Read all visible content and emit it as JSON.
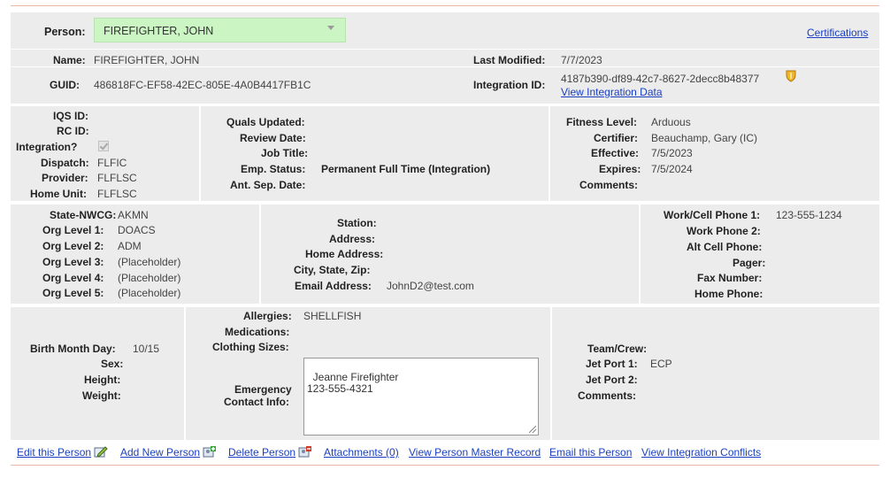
{
  "header": {
    "person_label": "Person:",
    "person_selected": "FIREFIGHTER, JOHN",
    "certifications_link": "Certifications"
  },
  "summary": {
    "name_label": "Name:",
    "name_value": "FIREFIGHTER, JOHN",
    "guid_label": "GUID:",
    "guid_value": "486818FC-EF58-42EC-805E-4A0B4417FB1C",
    "last_modified_label": "Last Modified:",
    "last_modified_value": "7/7/2023",
    "integration_id_label": "Integration ID:",
    "integration_id_value": "4187b390-df89-42c7-8627-2decc8b48377",
    "view_integration_data": "View Integration Data"
  },
  "ids": {
    "iqs_label": "IQS ID:",
    "rc_label": "RC ID:",
    "integration_label": "Integration?",
    "dispatch_label": "Dispatch:",
    "dispatch_value": "FLFIC",
    "provider_label": "Provider:",
    "provider_value": "FLFLSC",
    "home_unit_label": "Home Unit:",
    "home_unit_value": "FLFLSC"
  },
  "employment": {
    "quals_updated_label": "Quals Updated:",
    "review_date_label": "Review Date:",
    "job_title_label": "Job Title:",
    "emp_status_label": "Emp. Status:",
    "emp_status_value": "Permanent Full Time (Integration)",
    "ant_sep_label": "Ant. Sep. Date:"
  },
  "fitness": {
    "fitness_level_label": "Fitness Level:",
    "fitness_level_value": "Arduous",
    "certifier_label": "Certifier:",
    "certifier_value": "Beauchamp, Gary (IC)",
    "effective_label": "Effective:",
    "effective_value": "7/5/2023",
    "expires_label": "Expires:",
    "expires_value": "7/5/2024",
    "comments_label": "Comments:"
  },
  "org": {
    "state_label": "State-NWCG:",
    "state_value": "AKMN",
    "l1_label": "Org Level 1:",
    "l1_value": "DOACS",
    "l2_label": "Org Level 2:",
    "l2_value": "ADM",
    "l3_label": "Org Level 3:",
    "l3_value": "(Placeholder)",
    "l4_label": "Org Level 4:",
    "l4_value": "(Placeholder)",
    "l5_label": "Org Level 5:",
    "l5_value": "(Placeholder)"
  },
  "address": {
    "station_label": "Station:",
    "address_label": "Address:",
    "home_address_label": "Home Address:",
    "city_label": "City, State, Zip:",
    "email_label": "Email Address:",
    "email_value": "JohnD2@test.com"
  },
  "phones": {
    "work_cell_label": "Work/Cell Phone 1:",
    "work_cell_value": "123-555-1234",
    "work2_label": "Work Phone 2:",
    "alt_cell_label": "Alt Cell Phone:",
    "pager_label": "Pager:",
    "fax_label": "Fax Number:",
    "home_label": "Home Phone:"
  },
  "personal": {
    "birth_label": "Birth Month Day:",
    "birth_value": "10/15",
    "sex_label": "Sex:",
    "height_label": "Height:",
    "weight_label": "Weight:"
  },
  "medical": {
    "allergies_label": "Allergies:",
    "allergies_value": "SHELLFISH",
    "medications_label": "Medications:",
    "clothing_label": "Clothing Sizes:",
    "emergency_label_1": "Emergency",
    "emergency_label_2": "Contact Info:",
    "emergency_value": "Jeanne Firefighter\n123-555-4321"
  },
  "team": {
    "team_label": "Team/Crew:",
    "jet1_label": "Jet Port 1:",
    "jet1_value": "ECP",
    "jet2_label": "Jet Port 2:",
    "comments_label": "Comments:"
  },
  "footer": {
    "edit": "Edit this Person",
    "add": "Add New Person",
    "delete": "Delete Person",
    "attachments": "Attachments (0)",
    "master": "View Person Master Record",
    "email": "Email this Person",
    "conflicts": "View Integration Conflicts"
  },
  "colors": {
    "select_bg": "#ccf5c4",
    "panel_bg": "#ececec",
    "link": "#1a3fc0",
    "shield": "#f0b429"
  }
}
